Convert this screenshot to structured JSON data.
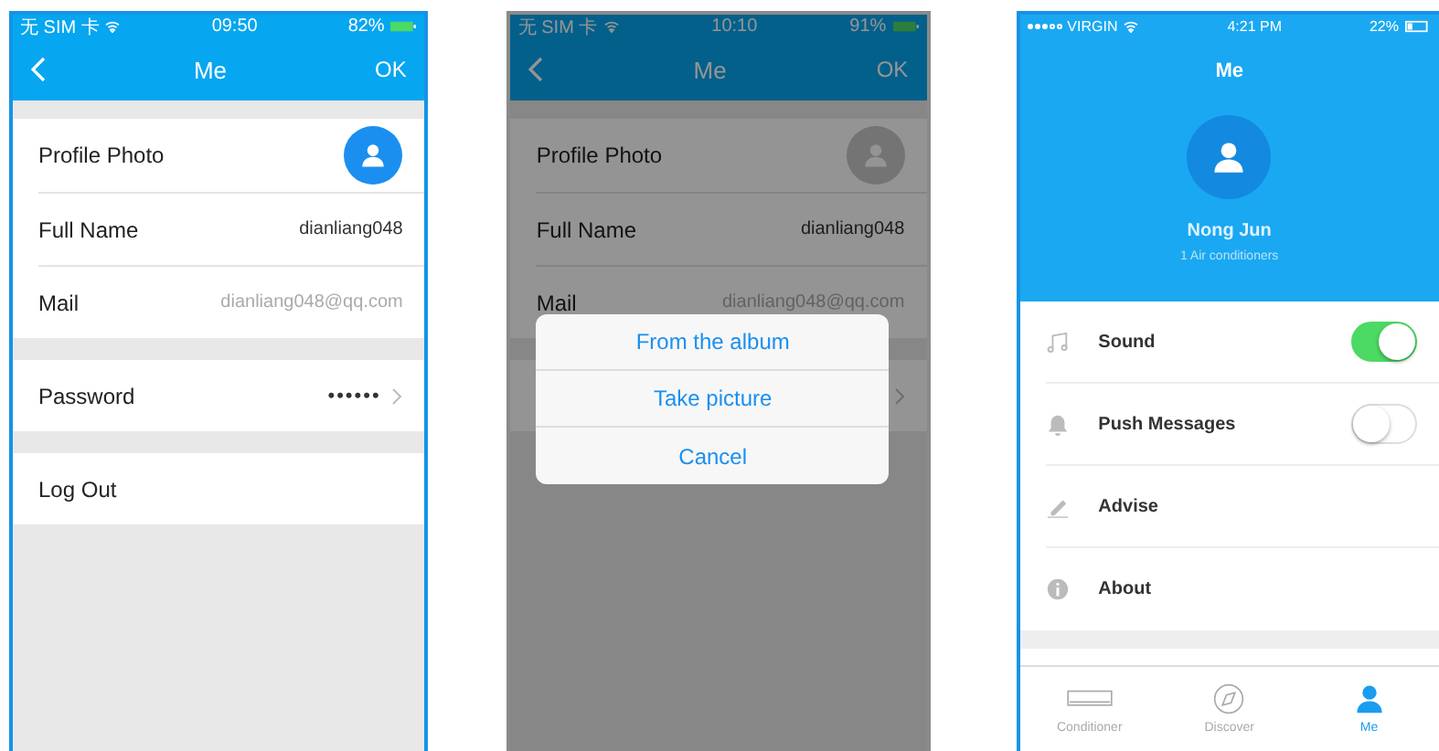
{
  "screens": [
    {
      "kind": "profile",
      "dimmed": false,
      "status": {
        "carrier": "无 SIM 卡",
        "time": "09:50",
        "battery": "82%"
      },
      "nav": {
        "title": "Me",
        "action": "OK"
      },
      "groups": [
        [
          {
            "kind": "photo",
            "label": "Profile Photo"
          },
          {
            "kind": "value",
            "label": "Full Name",
            "value": "dianliang048"
          },
          {
            "kind": "hint",
            "label": "Mail",
            "value": "dianliang048@qq.com"
          }
        ],
        [
          {
            "kind": "chevron",
            "label": "Password",
            "value": "••••••"
          }
        ],
        [
          {
            "kind": "plain",
            "label": "Log Out"
          }
        ]
      ]
    },
    {
      "kind": "profile",
      "dimmed": true,
      "status": {
        "carrier": "无 SIM 卡",
        "time": "10:10",
        "battery": "91%"
      },
      "nav": {
        "title": "Me",
        "action": "OK"
      },
      "groups": [
        [
          {
            "kind": "photo",
            "label": "Profile Photo"
          },
          {
            "kind": "value",
            "label": "Full Name",
            "value": "dianliang048"
          },
          {
            "kind": "hint",
            "label": "Mail",
            "value": "dianliang048@qq.com"
          }
        ],
        [
          {
            "kind": "chevron"
          }
        ]
      ],
      "sheet": [
        {
          "label": "From the album"
        },
        {
          "label": "Take picture"
        },
        {
          "label": "Cancel"
        }
      ]
    },
    {
      "kind": "settings",
      "status": {
        "carrier": "VIRGIN",
        "time": "4:21 PM",
        "battery": "22%"
      },
      "title": "Me",
      "user": {
        "name": "Nong Jun",
        "subtitle": "1 Air conditioners"
      },
      "settings": [
        {
          "kind": "toggle",
          "label": "Sound",
          "on": true
        },
        {
          "kind": "toggle",
          "label": "Push Messages",
          "on": false
        },
        {
          "kind": "link",
          "label": "Advise"
        },
        {
          "kind": "link",
          "label": "About"
        }
      ],
      "tabs": [
        {
          "label": "Conditioner",
          "selected": false
        },
        {
          "label": "Discover",
          "selected": false
        },
        {
          "label": "Me",
          "selected": true
        }
      ]
    }
  ]
}
